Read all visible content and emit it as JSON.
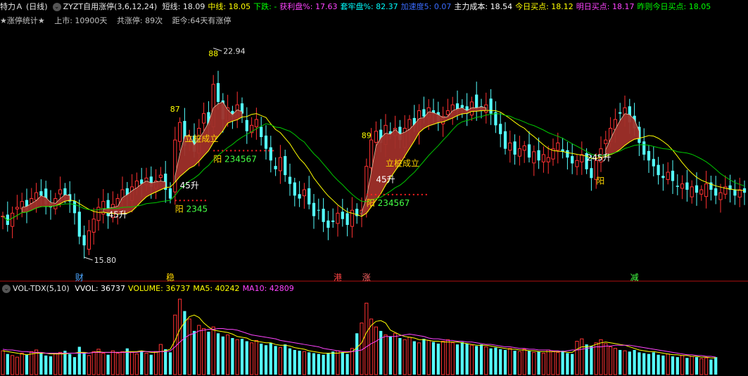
{
  "header": {
    "stock_name": "特力Ａ",
    "period": "(日线)",
    "indicator_name": "ZYZT自用涨停(3,6,12,24)",
    "items": [
      {
        "label": "短线:",
        "value": "18.09",
        "color": "#e8e8e8"
      },
      {
        "label": "中线:",
        "value": "18.05",
        "color": "#ffff00"
      },
      {
        "label": "下跌:",
        "value": "-",
        "color": "#00ff00"
      },
      {
        "label": "获利盘%:",
        "value": "17.63",
        "color": "#ff44ff"
      },
      {
        "label": "套牢盘%:",
        "value": "82.37",
        "color": "#00ffff"
      },
      {
        "label": "加速度5:",
        "value": "0.07",
        "color": "#3a6cff"
      },
      {
        "label": "主力成本:",
        "value": "18.54",
        "color": "#ffffff"
      },
      {
        "label": "今日买点:",
        "value": "18.12",
        "color": "#ffff00"
      },
      {
        "label": "明日买点:",
        "value": "18.17",
        "color": "#ff44ff"
      },
      {
        "label": "昨则今日买点:",
        "value": "18.05",
        "color": "#00ff00"
      }
    ]
  },
  "stats": {
    "title": "★涨停统计★",
    "listed": "上市: 10900天",
    "total_limit_up": "共涨停: 89次",
    "since_last": "距今:64天有涨停"
  },
  "volume_header": {
    "name": "VOL-TDX(5,10)",
    "items": [
      {
        "label": "VVOL:",
        "value": "36737",
        "color": "#ffffff"
      },
      {
        "label": "VOLUME:",
        "value": "36737",
        "color": "#ffff00"
      },
      {
        "label": "MA5:",
        "value": "40242",
        "color": "#ffff00"
      },
      {
        "label": "MA10:",
        "value": "42809",
        "color": "#ff44ff"
      }
    ]
  },
  "chart_data": {
    "type": "candlestick",
    "price_high_label": "22.94",
    "price_low_label": "15.80",
    "ylim": [
      15.2,
      23.6
    ],
    "count_labels": [
      {
        "text": "87",
        "index": 36
      },
      {
        "text": "88",
        "index": 44
      },
      {
        "text": "89",
        "index": 76
      }
    ],
    "annotations": [
      {
        "text": "立桩成立",
        "index": 38,
        "price": 19.85,
        "color": "#ffd700"
      },
      {
        "text": "立桩成立",
        "index": 80,
        "price": 19.0,
        "color": "#ffd700"
      },
      {
        "text": "45升",
        "index": 37,
        "price": 18.25,
        "color": "#ffffff"
      },
      {
        "text": "45升",
        "index": 78,
        "price": 18.45,
        "color": "#ffffff"
      },
      {
        "text": "45升",
        "index": 22,
        "price": 17.25,
        "color": "#ffffff"
      },
      {
        "text": "245升",
        "index": 122,
        "price": 19.2,
        "color": "#ffffff"
      },
      {
        "text": "阳",
        "index": 124,
        "price": 18.4,
        "color": "#ffd700"
      }
    ],
    "yang_labels": [
      {
        "prefix": "阳",
        "digits": "2345",
        "index": 36,
        "price": 17.45
      },
      {
        "prefix": "阳",
        "digits": "234567",
        "index": 44,
        "price": 19.15
      },
      {
        "prefix": "阳",
        "digits": "234567",
        "index": 76,
        "price": 17.65
      }
    ],
    "event_labels": [
      {
        "text": "财",
        "index": 16,
        "color": "#4da6ff"
      },
      {
        "text": "稳",
        "index": 35,
        "color": "#ffd700"
      },
      {
        "text": "港",
        "index": 70,
        "color": "#ff4444"
      },
      {
        "text": "涨",
        "index": 76,
        "color": "#ff6666"
      },
      {
        "text": "减",
        "index": 132,
        "color": "#44ff44"
      }
    ],
    "close": [
      17.3,
      17.0,
      17.4,
      17.6,
      17.8,
      17.5,
      17.9,
      18.1,
      18.0,
      17.7,
      17.6,
      17.9,
      18.2,
      18.0,
      17.8,
      17.4,
      16.6,
      16.3,
      16.8,
      17.2,
      17.6,
      17.8,
      17.3,
      17.7,
      17.9,
      18.2,
      18.0,
      18.3,
      18.5,
      18.4,
      18.6,
      18.3,
      18.5,
      18.7,
      18.2,
      17.9,
      19.9,
      20.5,
      19.7,
      20.0,
      19.5,
      20.3,
      20.8,
      20.4,
      21.8,
      21.2,
      20.6,
      21.0,
      20.7,
      21.1,
      20.8,
      20.2,
      20.4,
      20.6,
      20.0,
      19.6,
      19.2,
      18.9,
      19.3,
      18.7,
      18.4,
      18.0,
      17.9,
      18.2,
      17.7,
      17.3,
      17.5,
      17.1,
      16.9,
      17.1,
      17.4,
      17.2,
      17.0,
      17.5,
      17.3,
      17.5,
      19.0,
      19.9,
      20.2,
      19.8,
      20.4,
      20.1,
      20.3,
      19.9,
      20.3,
      20.6,
      20.4,
      20.9,
      20.7,
      21.0,
      20.8,
      20.5,
      20.7,
      20.9,
      21.1,
      20.9,
      21.0,
      20.8,
      21.2,
      21.0,
      20.9,
      21.1,
      20.8,
      20.4,
      20.1,
      19.6,
      19.8,
      19.4,
      19.6,
      19.7,
      19.3,
      19.5,
      19.2,
      19.4,
      19.3,
      19.6,
      19.8,
      19.5,
      19.3,
      19.1,
      19.2,
      19.4,
      18.9,
      18.6,
      19.2,
      19.6,
      19.9,
      20.3,
      20.6,
      20.8,
      21.0,
      20.5,
      20.3,
      19.8,
      19.4,
      19.2,
      19.0,
      18.7,
      18.6,
      18.8,
      18.5,
      18.3,
      18.4,
      18.2,
      18.3,
      18.1,
      18.2,
      18.4,
      18.2,
      18.0,
      18.1,
      18.3,
      18.2,
      18.0,
      18.2,
      18.1
    ],
    "volume": [
      30,
      26,
      24,
      22,
      27,
      25,
      29,
      31,
      27,
      24,
      23,
      26,
      28,
      30,
      26,
      22,
      35,
      28,
      24,
      29,
      32,
      27,
      25,
      30,
      27,
      29,
      33,
      28,
      26,
      30,
      27,
      25,
      29,
      38,
      32,
      28,
      75,
      95,
      80,
      70,
      55,
      62,
      58,
      54,
      60,
      52,
      48,
      50,
      46,
      44,
      45,
      42,
      40,
      43,
      39,
      37,
      40,
      36,
      34,
      38,
      33,
      31,
      30,
      29,
      28,
      27,
      26,
      25,
      27,
      29,
      30,
      28,
      26,
      33,
      52,
      65,
      90,
      70,
      60,
      55,
      50,
      48,
      52,
      46,
      44,
      47,
      42,
      40,
      45,
      43,
      41,
      39,
      42,
      44,
      40,
      38,
      41,
      39,
      37,
      36,
      38,
      35,
      33,
      34,
      32,
      31,
      33,
      30,
      29,
      32,
      30,
      28,
      29,
      27,
      31,
      29,
      28,
      30,
      27,
      26,
      42,
      45,
      38,
      36,
      40,
      44,
      39,
      35,
      33,
      31,
      30,
      29,
      31,
      28,
      27,
      26,
      28,
      25,
      24,
      26,
      23,
      22,
      24,
      21,
      23,
      22,
      20,
      21,
      19,
      22
    ],
    "ma5": [
      30,
      29,
      28,
      27,
      26,
      25,
      26,
      27,
      27,
      27,
      26,
      26,
      26,
      26,
      27,
      27,
      28,
      28,
      27,
      28,
      29,
      28,
      28,
      28,
      28,
      28,
      29,
      29,
      29,
      30,
      29,
      28,
      28,
      29,
      30,
      32,
      43,
      57,
      66,
      73,
      75,
      72,
      65,
      60,
      56,
      55,
      54,
      53,
      51,
      48,
      47,
      46,
      43,
      42,
      41,
      40,
      40,
      38,
      37,
      37,
      36,
      34,
      33,
      32,
      30,
      29,
      28,
      27,
      27,
      27,
      27,
      28,
      28,
      29,
      34,
      40,
      53,
      62,
      67,
      68,
      65,
      56,
      53,
      50,
      48,
      47,
      46,
      44,
      44,
      43,
      42,
      42,
      41,
      41,
      41,
      41,
      40,
      39,
      38,
      37,
      37,
      37,
      36,
      35,
      34,
      33,
      32,
      32,
      31,
      31,
      30,
      30,
      29,
      29,
      29,
      29,
      29,
      29,
      28,
      28,
      32,
      35,
      35,
      36,
      38,
      40,
      41,
      40,
      39,
      38,
      37,
      35,
      33,
      31,
      30,
      29,
      29,
      28,
      27,
      26,
      25,
      25,
      24,
      24,
      23,
      23,
      22,
      22,
      21,
      21
    ],
    "ma10": [
      32,
      31,
      31,
      30,
      29,
      29,
      28,
      28,
      28,
      27,
      27,
      27,
      27,
      27,
      27,
      27,
      27,
      27,
      27,
      28,
      28,
      28,
      28,
      28,
      28,
      28,
      28,
      28,
      28,
      29,
      29,
      29,
      29,
      29,
      29,
      30,
      35,
      41,
      46,
      50,
      52,
      55,
      56,
      57,
      57,
      58,
      58,
      57,
      57,
      56,
      54,
      52,
      50,
      49,
      48,
      47,
      46,
      45,
      43,
      42,
      41,
      40,
      39,
      38,
      37,
      36,
      35,
      33,
      32,
      31,
      30,
      29,
      29,
      29,
      30,
      31,
      35,
      39,
      42,
      46,
      48,
      48,
      48,
      49,
      50,
      51,
      50,
      49,
      48,
      46,
      45,
      45,
      44,
      43,
      43,
      42,
      42,
      41,
      41,
      40,
      39,
      38,
      38,
      37,
      36,
      35,
      35,
      34,
      33,
      33,
      32,
      32,
      31,
      31,
      31,
      30,
      30,
      29,
      30,
      31,
      31,
      32,
      33,
      34,
      35,
      35,
      36,
      36,
      37,
      37,
      37,
      37,
      36,
      35,
      34,
      33,
      32,
      31,
      30,
      29,
      28,
      27,
      26,
      25,
      25,
      24,
      24,
      23,
      23,
      22
    ]
  }
}
